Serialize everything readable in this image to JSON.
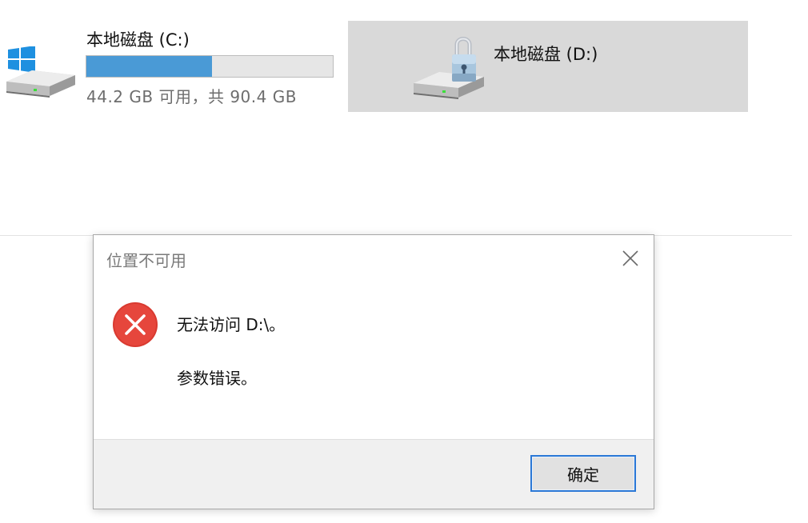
{
  "drives": [
    {
      "name": "本地磁盘 (C:)",
      "space_text": "44.2 GB 可用，共 90.4 GB",
      "free_gb": 44.2,
      "total_gb": 90.4,
      "used_fraction": 0.511,
      "bar_color": "#4a9ad6",
      "icon": "windows-drive-icon"
    },
    {
      "name": "本地磁盘 (D:)",
      "icon": "locked-drive-icon",
      "selected": true
    }
  ],
  "dialog": {
    "title": "位置不可用",
    "close_icon": "close-icon",
    "error_icon": "error-icon",
    "message_line1": "无法访问 D:\\。",
    "message_line2": "参数错误。",
    "ok_label": "确定",
    "accent_color": "#2b78d6",
    "error_color": "#e0443b"
  }
}
